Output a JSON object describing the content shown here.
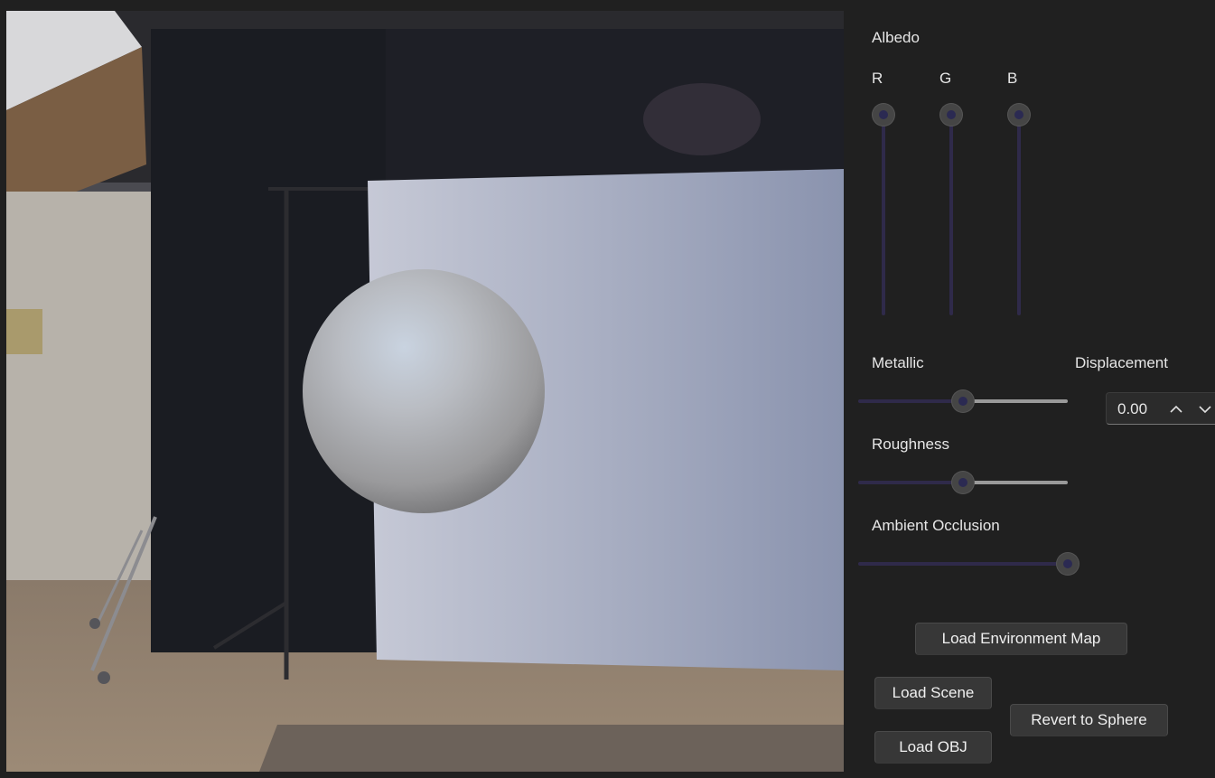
{
  "albedo": {
    "label": "Albedo",
    "channels": [
      {
        "label": "R",
        "value": 1.0
      },
      {
        "label": "G",
        "value": 1.0
      },
      {
        "label": "B",
        "value": 1.0
      }
    ]
  },
  "metallic": {
    "label": "Metallic",
    "value": 0.5
  },
  "roughness": {
    "label": "Roughness",
    "value": 0.5
  },
  "ambient_occlusion": {
    "label": "Ambient Occlusion",
    "value": 1.0
  },
  "displacement": {
    "label": "Displacement",
    "value": "0.00"
  },
  "buttons": {
    "load_env": "Load Environment Map",
    "load_scene": "Load Scene",
    "load_obj": "Load OBJ",
    "revert": "Revert to Sphere"
  },
  "colors": {
    "track_fill": "#9a9a9a",
    "track_empty": "#2f2a4a",
    "panel_bg": "#202020",
    "button_bg": "#373737"
  },
  "icons": {
    "spin_up": "chevron-up-icon",
    "spin_down": "chevron-down-icon"
  }
}
